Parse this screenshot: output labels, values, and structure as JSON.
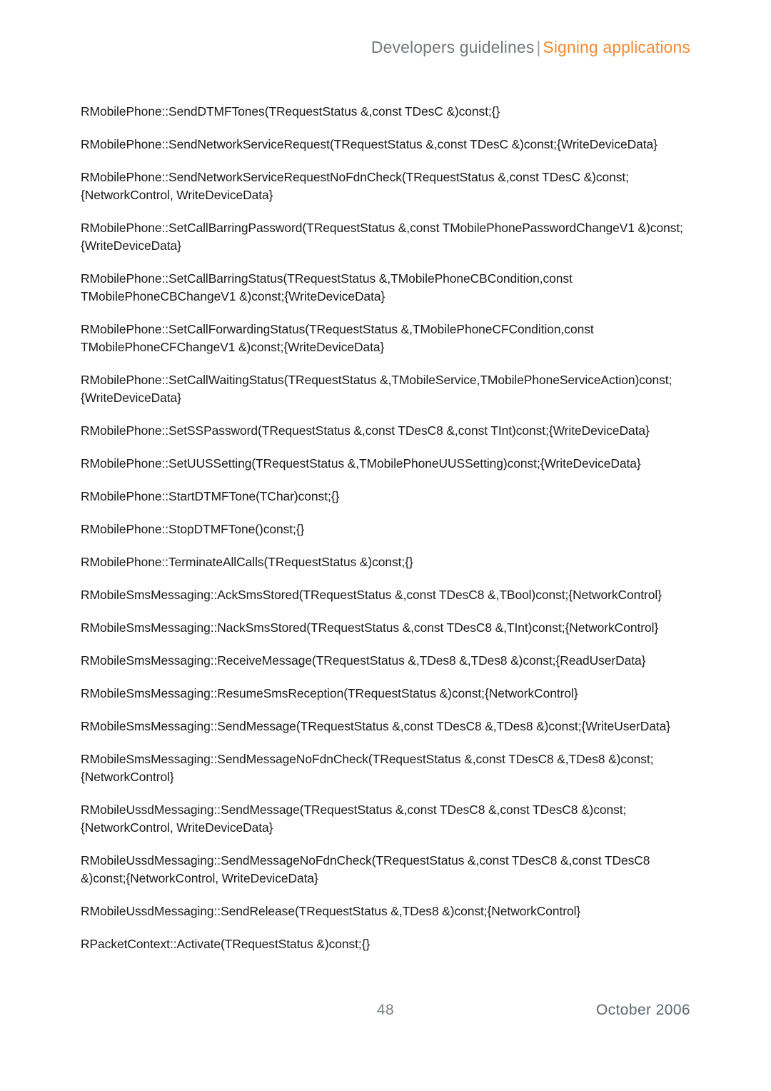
{
  "header": {
    "section": "Developers guidelines",
    "separator": "|",
    "topic": "Signing applications",
    "section_color": "#74787d",
    "topic_color": "#f58a33"
  },
  "document": {
    "title": "Developers guidelines | Signing applications",
    "api_entries": [
      "RMobilePhone::SendDTMFTones(TRequestStatus &,const TDesC &)const;{}",
      "RMobilePhone::SendNetworkServiceRequest(TRequestStatus &,const TDesC &)const;{WriteDeviceData}",
      "RMobilePhone::SendNetworkServiceRequestNoFdnCheck(TRequestStatus &,const TDesC &)const;{NetworkControl, WriteDeviceData}",
      "RMobilePhone::SetCallBarringPassword(TRequestStatus &,const TMobilePhonePasswordChangeV1 &)const;{WriteDeviceData}",
      "RMobilePhone::SetCallBarringStatus(TRequestStatus &,TMobilePhoneCBCondition,const TMobilePhoneCBChangeV1 &)const;{WriteDeviceData}",
      "RMobilePhone::SetCallForwardingStatus(TRequestStatus &,TMobilePhoneCFCondition,const TMobilePhoneCFChangeV1 &)const;{WriteDeviceData}",
      "RMobilePhone::SetCallWaitingStatus(TRequestStatus &,TMobileService,TMobilePhoneServiceAction)const;{WriteDeviceData}",
      "RMobilePhone::SetSSPassword(TRequestStatus &,const TDesC8 &,const TInt)const;{WriteDeviceData}",
      "RMobilePhone::SetUUSSetting(TRequestStatus &,TMobilePhoneUUSSetting)const;{WriteDeviceData}",
      "RMobilePhone::StartDTMFTone(TChar)const;{}",
      "RMobilePhone::StopDTMFTone()const;{}",
      "RMobilePhone::TerminateAllCalls(TRequestStatus &)const;{}",
      "RMobileSmsMessaging::AckSmsStored(TRequestStatus &,const TDesC8 &,TBool)const;{NetworkControl}",
      "RMobileSmsMessaging::NackSmsStored(TRequestStatus &,const TDesC8 &,TInt)const;{NetworkControl}",
      "RMobileSmsMessaging::ReceiveMessage(TRequestStatus &,TDes8 &,TDes8 &)const;{ReadUserData}",
      "RMobileSmsMessaging::ResumeSmsReception(TRequestStatus &)const;{NetworkControl}",
      "RMobileSmsMessaging::SendMessage(TRequestStatus &,const TDesC8 &,TDes8 &)const;{WriteUserData}",
      "RMobileSmsMessaging::SendMessageNoFdnCheck(TRequestStatus &,const TDesC8 &,TDes8 &)const;{NetworkControl}",
      "RMobileUssdMessaging::SendMessage(TRequestStatus &,const TDesC8 &,const TDesC8 &)const;{NetworkControl, WriteDeviceData}",
      "RMobileUssdMessaging::SendMessageNoFdnCheck(TRequestStatus &,const TDesC8 &,const TDesC8 &)const;{NetworkControl, WriteDeviceData}",
      "RMobileUssdMessaging::SendRelease(TRequestStatus &,TDes8 &)const;{NetworkControl}",
      "RPacketContext::Activate(TRequestStatus &)const;{}"
    ]
  },
  "footer": {
    "page_number": "48",
    "date": "October 2006"
  }
}
